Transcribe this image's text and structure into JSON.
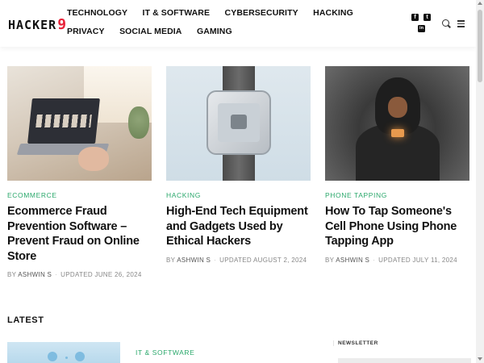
{
  "site": {
    "logo_main": "HACKER",
    "logo_accent": "9"
  },
  "nav": {
    "items": [
      "TECHNOLOGY",
      "IT & SOFTWARE",
      "CYBERSECURITY",
      "HACKING",
      "PRIVACY",
      "SOCIAL MEDIA",
      "GAMING"
    ]
  },
  "social": {
    "facebook": "f",
    "twitter": "t",
    "linkedin": "in"
  },
  "featured": [
    {
      "category": "ECOMMERCE",
      "title": "Ecommerce Fraud Prevention Software – Prevent Fraud on Online Store",
      "by": "BY",
      "author": "ASHWIN S",
      "updated": "UPDATED JUNE 26, 2024"
    },
    {
      "category": "HACKING",
      "title": "High-End Tech Equipment and Gadgets Used by Ethical Hackers",
      "by": "BY",
      "author": "ASHWIN S",
      "updated": "UPDATED AUGUST 2, 2024"
    },
    {
      "category": "PHONE TAPPING",
      "title": "How To Tap Someone's Cell Phone Using Phone Tapping App",
      "by": "BY",
      "author": "ASHWIN S",
      "updated": "UPDATED JULY 11, 2024"
    }
  ],
  "latest": {
    "heading": "LATEST",
    "first_category": "IT & SOFTWARE"
  },
  "sidebar": {
    "newsletter_label": "NEWSLETTER"
  },
  "colors": {
    "accent_green": "#2aa86b",
    "logo_red": "#e8233a"
  }
}
